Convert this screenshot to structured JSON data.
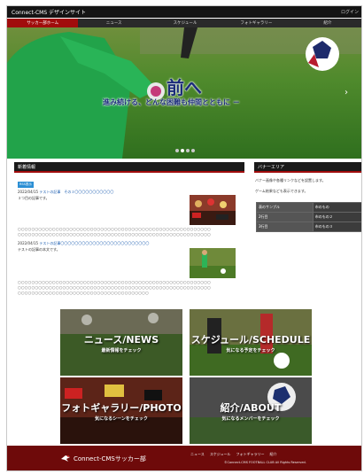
{
  "header": {
    "site_title": "Connect-CMS デザインサイト",
    "login": "ログイン"
  },
  "nav": {
    "items": [
      "サッカー部ホーム",
      "ニュース",
      "スケジュール",
      "フォトギャラリー",
      "紹介"
    ]
  },
  "hero": {
    "copy_main": "前へ",
    "copy_sub": "進み続ける、どんな困難も仲間とともに －",
    "next_arrow": "›",
    "slide_count": 4,
    "active_slide": 2
  },
  "news": {
    "heading": "新着情報",
    "rss": "RSS表示",
    "posts": [
      {
        "date": "2022/04/15",
        "title": "テストの記事　その３〇〇〇〇〇〇〇〇〇〇〇",
        "excerpt": "３つ目の記事です。",
        "body1": "〇〇〇〇〇〇〇〇〇〇〇〇〇〇〇〇〇〇〇〇〇〇〇〇〇〇〇〇〇〇〇〇〇〇〇〇〇〇〇〇〇〇〇〇〇〇〇〇〇〇〇〇〇〇〇〇",
        "body2": "〇〇〇〇〇〇〇〇〇〇〇〇〇〇〇〇〇〇〇〇〇〇〇〇〇〇〇〇〇〇〇〇〇〇〇〇〇〇〇〇〇〇〇〇〇〇〇〇〇〇〇〇〇〇〇〇"
      },
      {
        "date": "2022/04/15",
        "title": "テストの記事〇〇〇〇〇〇〇〇〇〇〇〇〇〇〇〇〇〇〇〇〇〇〇〇〇",
        "excerpt": "テストの記事の本文です。",
        "body1": "〇〇〇〇〇〇〇〇〇〇〇〇〇〇〇〇〇〇〇〇〇〇〇〇〇〇〇〇〇〇〇〇〇〇〇〇〇〇〇〇〇〇〇〇〇〇〇〇〇〇〇〇〇〇〇〇",
        "body2": "〇〇〇〇〇〇〇〇〇〇〇〇〇〇〇〇〇〇〇〇〇〇〇〇〇〇〇〇〇〇〇〇〇〇〇〇〇〇〇〇〇〇〇〇〇〇〇〇〇〇〇〇〇〇〇〇",
        "body3": "〇〇〇〇〇〇〇〇〇〇〇〇〇〇〇〇〇〇〇〇〇〇〇〇〇〇〇〇〇〇〇〇〇〇〇〇〇〇"
      }
    ]
  },
  "banner_area": {
    "heading": "バナーエリア",
    "desc1": "バナー画像や各種リンクなどを設置します。",
    "desc2": "ゲーム結果なども表示できます。",
    "table": [
      [
        "表のサンプル",
        "市のもの"
      ],
      [
        "2行目",
        "市のもの２"
      ],
      [
        "3行目",
        "市のもの３"
      ]
    ]
  },
  "tiles": [
    {
      "title": "ニュース/NEWS",
      "sub": "最新情報をチェック"
    },
    {
      "title": "スケジュール/SCHEDULE",
      "sub": "気になる予定をチェック"
    },
    {
      "title": "フォトギャラリー/PHOTO",
      "sub": "気になるシーンをチェック"
    },
    {
      "title": "紹介/ABOUT",
      "sub": "気になるメンバーをチェック"
    }
  ],
  "footer": {
    "logo": "Connect-CMSサッカー部",
    "links": [
      "ニュース",
      "スケジュール",
      "フォトギャラリー",
      "紹介"
    ],
    "copyright": "©Connect-CMS FOOTBALL CLUB All Rights Reserved."
  },
  "colors": {
    "accent": "#a10c0c",
    "footer": "#6e0a0a",
    "link": "#1a5cb0"
  }
}
